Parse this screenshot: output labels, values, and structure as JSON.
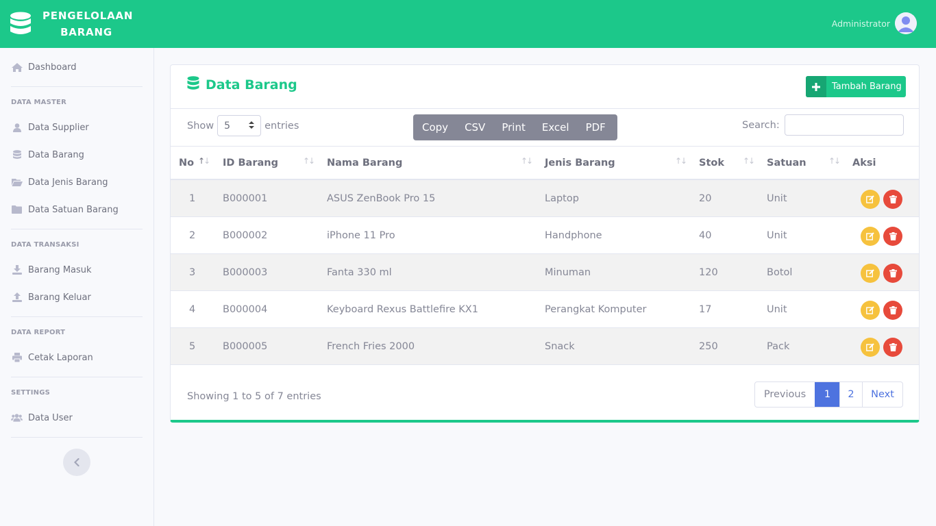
{
  "header": {
    "brand_line1": "PENGELOLAAN",
    "brand_line2": "BARANG",
    "user_name": "Administrator"
  },
  "sidebar": {
    "dashboard": "Dashboard",
    "heading_master": "DATA MASTER",
    "supplier": "Data Supplier",
    "barang": "Data Barang",
    "jenis_barang": "Data Jenis Barang",
    "satuan_barang": "Data Satuan Barang",
    "heading_transaksi": "DATA TRANSAKSI",
    "barang_masuk": "Barang Masuk",
    "barang_keluar": "Barang Keluar",
    "heading_report": "DATA REPORT",
    "cetak_laporan": "Cetak Laporan",
    "heading_settings": "SETTINGS",
    "data_user": "Data User"
  },
  "card": {
    "title": "Data Barang",
    "add_button": "Tambah Barang",
    "show_label": "Show",
    "entries_label": "entries",
    "page_length": "5",
    "export_buttons": [
      "Copy",
      "CSV",
      "Print",
      "Excel",
      "PDF"
    ],
    "search_label": "Search:",
    "search_value": ""
  },
  "table": {
    "columns": [
      "No",
      "ID Barang",
      "Nama Barang",
      "Jenis Barang",
      "Stok",
      "Satuan",
      "Aksi"
    ],
    "rows": [
      [
        "1",
        "B000001",
        "ASUS ZenBook Pro 15",
        "Laptop",
        "20",
        "Unit"
      ],
      [
        "2",
        "B000002",
        "iPhone 11 Pro",
        "Handphone",
        "40",
        "Unit"
      ],
      [
        "3",
        "B000003",
        "Fanta 330 ml",
        "Minuman",
        "120",
        "Botol"
      ],
      [
        "4",
        "B000004",
        "Keyboard Rexus Battlefire KX1",
        "Perangkat Komputer",
        "17",
        "Unit"
      ],
      [
        "5",
        "B000005",
        "French Fries 2000",
        "Snack",
        "250",
        "Pack"
      ]
    ]
  },
  "footer": {
    "info": "Showing 1 to 5 of 7 entries",
    "prev": "Previous",
    "page1": "1",
    "page2": "2",
    "next": "Next"
  },
  "colors": {
    "primary_green": "#1cc88a",
    "pagination_blue": "#4e73df",
    "edit_yellow": "#f6c23e",
    "delete_red": "#e74a3b",
    "export_gray": "#858796"
  }
}
